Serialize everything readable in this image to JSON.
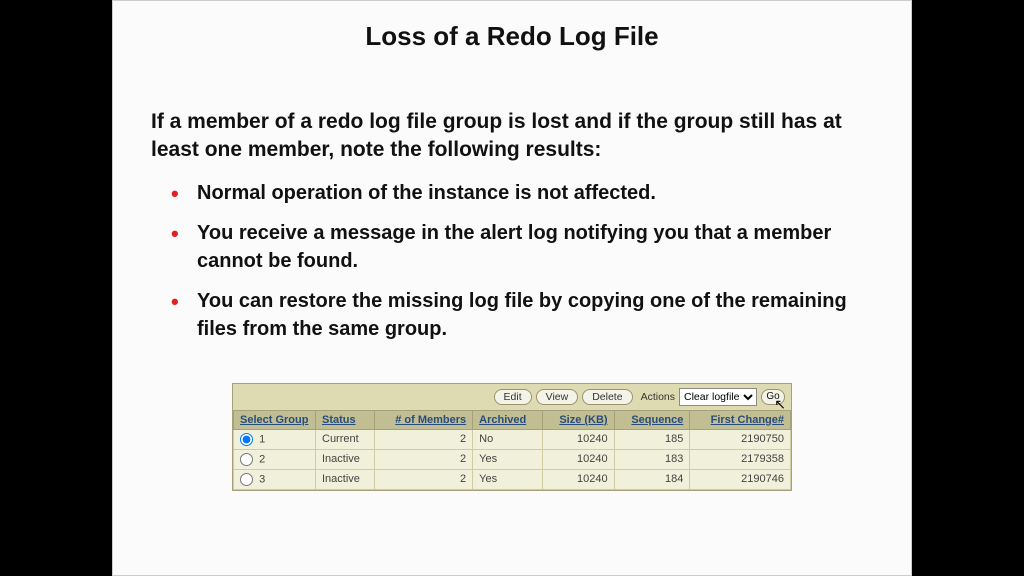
{
  "title": "Loss of a Redo Log File",
  "intro": "If a member of a redo log file group is lost and if the group still has at least one member, note the following results:",
  "bullets": [
    "Normal operation of the instance is not affected.",
    "You receive a message in the alert log notifying you that a member cannot be found.",
    "You can restore the missing log file by copying one of the remaining files from the same group."
  ],
  "toolbar": {
    "edit": "Edit",
    "view": "View",
    "delete": "Delete",
    "actions_label": "Actions",
    "action_selected": "Clear logfile",
    "go": "Go"
  },
  "columns": {
    "select": "Select Group",
    "status": "Status",
    "members": "# of Members",
    "archived": "Archived",
    "size": "Size (KB)",
    "sequence": "Sequence",
    "first_change": "First Change#"
  },
  "rows": [
    {
      "selected": true,
      "group": "1",
      "status": "Current",
      "members": "2",
      "archived": "No",
      "size": "10240",
      "sequence": "185",
      "first_change": "2190750"
    },
    {
      "selected": false,
      "group": "2",
      "status": "Inactive",
      "members": "2",
      "archived": "Yes",
      "size": "10240",
      "sequence": "183",
      "first_change": "2179358"
    },
    {
      "selected": false,
      "group": "3",
      "status": "Inactive",
      "members": "2",
      "archived": "Yes",
      "size": "10240",
      "sequence": "184",
      "first_change": "2190746"
    }
  ]
}
